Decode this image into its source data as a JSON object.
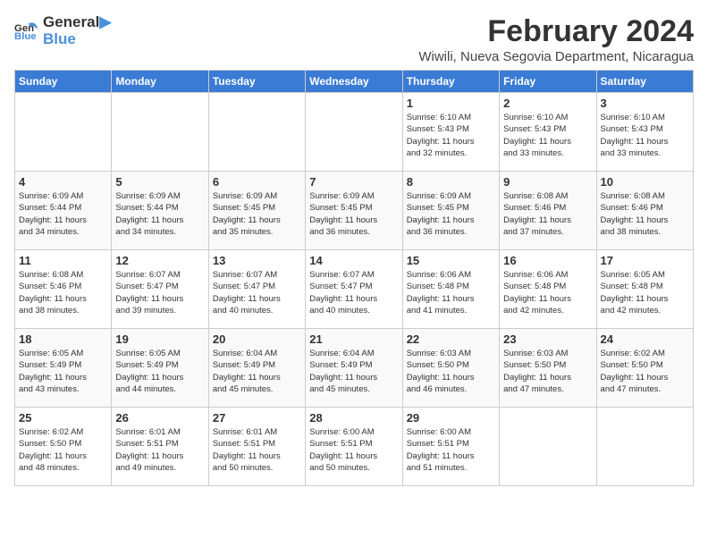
{
  "logo": {
    "line1": "General",
    "line2": "Blue"
  },
  "title": "February 2024",
  "location": "Wiwili, Nueva Segovia Department, Nicaragua",
  "days_of_week": [
    "Sunday",
    "Monday",
    "Tuesday",
    "Wednesday",
    "Thursday",
    "Friday",
    "Saturday"
  ],
  "weeks": [
    [
      {
        "day": "",
        "info": ""
      },
      {
        "day": "",
        "info": ""
      },
      {
        "day": "",
        "info": ""
      },
      {
        "day": "",
        "info": ""
      },
      {
        "day": "1",
        "info": "Sunrise: 6:10 AM\nSunset: 5:43 PM\nDaylight: 11 hours\nand 32 minutes."
      },
      {
        "day": "2",
        "info": "Sunrise: 6:10 AM\nSunset: 5:43 PM\nDaylight: 11 hours\nand 33 minutes."
      },
      {
        "day": "3",
        "info": "Sunrise: 6:10 AM\nSunset: 5:43 PM\nDaylight: 11 hours\nand 33 minutes."
      }
    ],
    [
      {
        "day": "4",
        "info": "Sunrise: 6:09 AM\nSunset: 5:44 PM\nDaylight: 11 hours\nand 34 minutes."
      },
      {
        "day": "5",
        "info": "Sunrise: 6:09 AM\nSunset: 5:44 PM\nDaylight: 11 hours\nand 34 minutes."
      },
      {
        "day": "6",
        "info": "Sunrise: 6:09 AM\nSunset: 5:45 PM\nDaylight: 11 hours\nand 35 minutes."
      },
      {
        "day": "7",
        "info": "Sunrise: 6:09 AM\nSunset: 5:45 PM\nDaylight: 11 hours\nand 36 minutes."
      },
      {
        "day": "8",
        "info": "Sunrise: 6:09 AM\nSunset: 5:45 PM\nDaylight: 11 hours\nand 36 minutes."
      },
      {
        "day": "9",
        "info": "Sunrise: 6:08 AM\nSunset: 5:46 PM\nDaylight: 11 hours\nand 37 minutes."
      },
      {
        "day": "10",
        "info": "Sunrise: 6:08 AM\nSunset: 5:46 PM\nDaylight: 11 hours\nand 38 minutes."
      }
    ],
    [
      {
        "day": "11",
        "info": "Sunrise: 6:08 AM\nSunset: 5:46 PM\nDaylight: 11 hours\nand 38 minutes."
      },
      {
        "day": "12",
        "info": "Sunrise: 6:07 AM\nSunset: 5:47 PM\nDaylight: 11 hours\nand 39 minutes."
      },
      {
        "day": "13",
        "info": "Sunrise: 6:07 AM\nSunset: 5:47 PM\nDaylight: 11 hours\nand 40 minutes."
      },
      {
        "day": "14",
        "info": "Sunrise: 6:07 AM\nSunset: 5:47 PM\nDaylight: 11 hours\nand 40 minutes."
      },
      {
        "day": "15",
        "info": "Sunrise: 6:06 AM\nSunset: 5:48 PM\nDaylight: 11 hours\nand 41 minutes."
      },
      {
        "day": "16",
        "info": "Sunrise: 6:06 AM\nSunset: 5:48 PM\nDaylight: 11 hours\nand 42 minutes."
      },
      {
        "day": "17",
        "info": "Sunrise: 6:05 AM\nSunset: 5:48 PM\nDaylight: 11 hours\nand 42 minutes."
      }
    ],
    [
      {
        "day": "18",
        "info": "Sunrise: 6:05 AM\nSunset: 5:49 PM\nDaylight: 11 hours\nand 43 minutes."
      },
      {
        "day": "19",
        "info": "Sunrise: 6:05 AM\nSunset: 5:49 PM\nDaylight: 11 hours\nand 44 minutes."
      },
      {
        "day": "20",
        "info": "Sunrise: 6:04 AM\nSunset: 5:49 PM\nDaylight: 11 hours\nand 45 minutes."
      },
      {
        "day": "21",
        "info": "Sunrise: 6:04 AM\nSunset: 5:49 PM\nDaylight: 11 hours\nand 45 minutes."
      },
      {
        "day": "22",
        "info": "Sunrise: 6:03 AM\nSunset: 5:50 PM\nDaylight: 11 hours\nand 46 minutes."
      },
      {
        "day": "23",
        "info": "Sunrise: 6:03 AM\nSunset: 5:50 PM\nDaylight: 11 hours\nand 47 minutes."
      },
      {
        "day": "24",
        "info": "Sunrise: 6:02 AM\nSunset: 5:50 PM\nDaylight: 11 hours\nand 47 minutes."
      }
    ],
    [
      {
        "day": "25",
        "info": "Sunrise: 6:02 AM\nSunset: 5:50 PM\nDaylight: 11 hours\nand 48 minutes."
      },
      {
        "day": "26",
        "info": "Sunrise: 6:01 AM\nSunset: 5:51 PM\nDaylight: 11 hours\nand 49 minutes."
      },
      {
        "day": "27",
        "info": "Sunrise: 6:01 AM\nSunset: 5:51 PM\nDaylight: 11 hours\nand 50 minutes."
      },
      {
        "day": "28",
        "info": "Sunrise: 6:00 AM\nSunset: 5:51 PM\nDaylight: 11 hours\nand 50 minutes."
      },
      {
        "day": "29",
        "info": "Sunrise: 6:00 AM\nSunset: 5:51 PM\nDaylight: 11 hours\nand 51 minutes."
      },
      {
        "day": "",
        "info": ""
      },
      {
        "day": "",
        "info": ""
      }
    ]
  ]
}
